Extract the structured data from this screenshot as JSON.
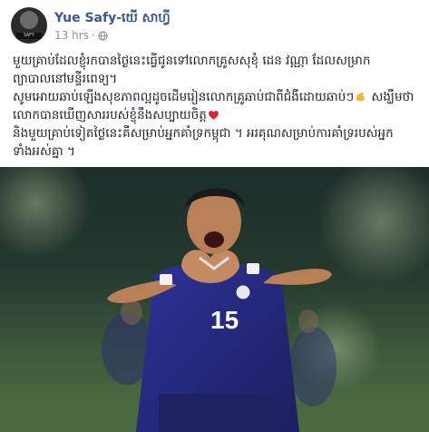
{
  "post": {
    "author": "Yue Safy-យើ សាហ្វី",
    "time": "13 hrs",
    "separator": "·",
    "avatar_text": "SAFY",
    "lines": [
      "មួយគ្រាប់ដែលខ្ញុំរកបានថ្ងៃនេះធ្វើជូនទៅលោកគ្រូសសុខុំ ដេន វណ្ណា ដែលសម្រាក",
      "ព្យាបាលនៅមន្ទីរពេទ្យ។",
      "សូមអោយឆាប់ឡើងសុខភាពល្អដូចដើមរៀនលោកគ្រូឆាប់ជាពីជំងឺដោយឆាប់ៗ",
      "សង្ឃឹមថាលោកបានឃើញសាររបស់ខ្ញុំនឹងសប្បាយចិត្ត",
      "និងមួយគ្រាប់ទៀតថ្ងៃនេះគឺសម្រាប់អ្នកគាំទ្រកម្ពុជា ។ អរគុណសម្រាប់ការគាំទ្ររបស់អ្នក",
      "ទាំងអស់គ្នា ។"
    ],
    "emoji_1": "flexed-biceps-emoji",
    "emoji_2": "red-heart-emoji",
    "photo_jersey_number": "15",
    "colors": {
      "link": "#385898",
      "meta": "#90949c",
      "jersey": "#2b2f8a"
    }
  }
}
